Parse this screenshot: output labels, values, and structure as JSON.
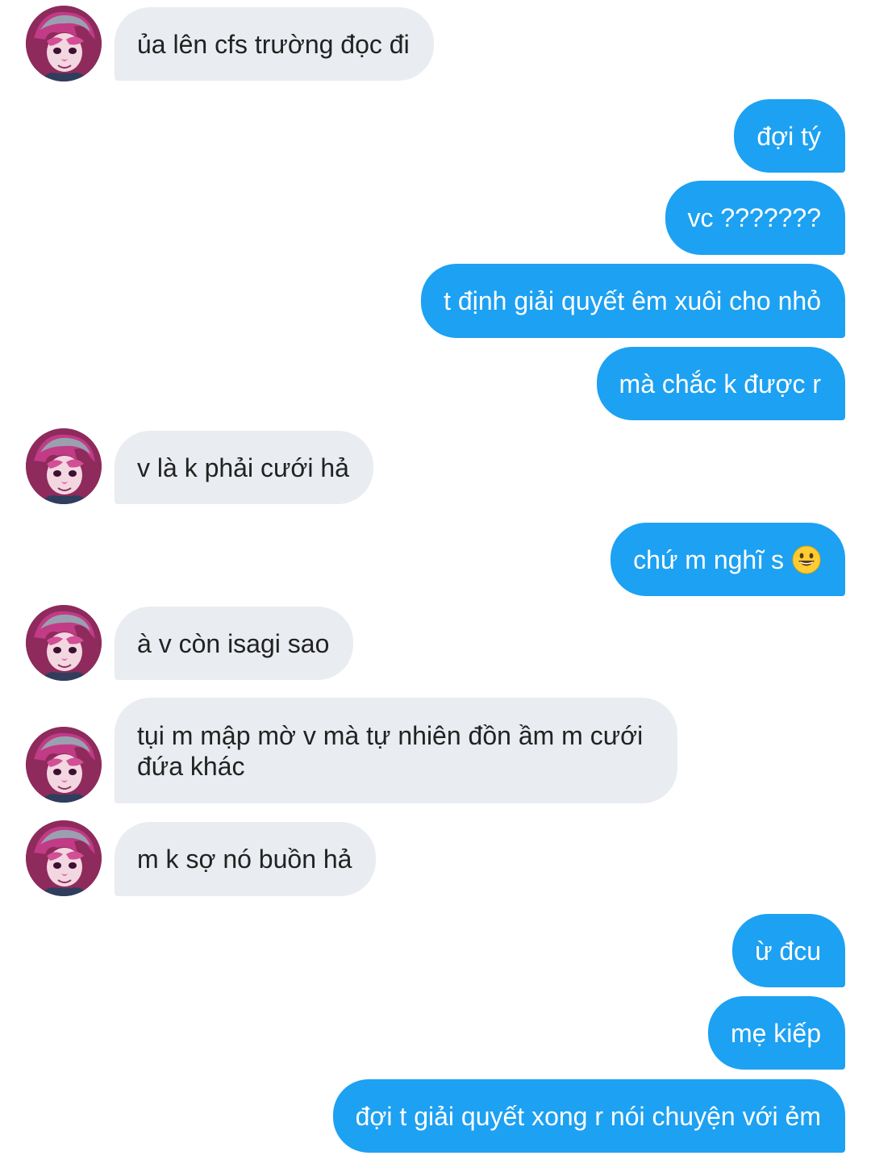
{
  "conversation": {
    "messages": [
      {
        "from": "them",
        "text": "ủa lên cfs trường đọc đi"
      },
      {
        "from": "me",
        "text": "đợi tý"
      },
      {
        "from": "me",
        "text": "vc ???????"
      },
      {
        "from": "me",
        "text": "t định giải quyết êm xuôi cho nhỏ"
      },
      {
        "from": "me",
        "text": "mà chắc k được r"
      },
      {
        "from": "them",
        "text": "v là k phải cưới hả"
      },
      {
        "from": "me",
        "text": "chứ m nghĩ s",
        "emoji": "grinning-face-emoji"
      },
      {
        "from": "them",
        "text": "à v còn isagi sao"
      },
      {
        "from": "them",
        "text": "tụi m mập mờ v mà tự nhiên đồn ầm m cưới đứa khác"
      },
      {
        "from": "them",
        "text": "m k sợ nó buồn hả"
      },
      {
        "from": "me",
        "text": "ừ đcu"
      },
      {
        "from": "me",
        "text": "mẹ kiếp"
      },
      {
        "from": "me",
        "text": "đợi t giải quyết xong r nói chuyện với ẻm"
      }
    ]
  },
  "colors": {
    "outgoing_bubble": "#1da1f2",
    "incoming_bubble": "#e9ecf0",
    "incoming_text": "#222222",
    "outgoing_text": "#ffffff"
  },
  "icons": {
    "avatar": "contact-avatar",
    "emoji": "grinning-face-emoji"
  }
}
